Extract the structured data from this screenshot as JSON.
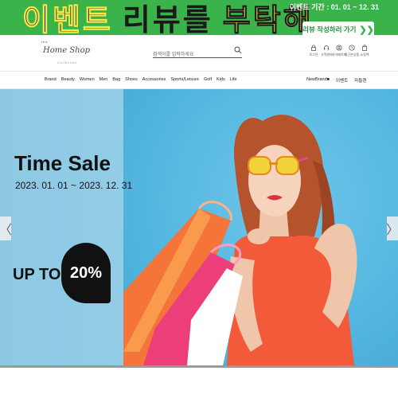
{
  "event_banner": {
    "slogan_part1": "이벤트",
    "slogan_part2": "리뷰를",
    "slogan_part3": "부탁해",
    "period": "이벤트 기간 : 01. 01 ~ 12. 31",
    "cta_label": "리뷰 작성하러 가기",
    "cta_arrows": "❯❯",
    "color_bg": "#39b34a"
  },
  "header": {
    "logo": {
      "the": "the",
      "name": "Home Shop",
      "sub": "Collection"
    },
    "search": {
      "placeholder": "검색어를 입력하세요"
    },
    "utility": [
      {
        "label": "로그인",
        "icon": "lock-icon"
      },
      {
        "label": "고객센터",
        "icon": "headset-icon"
      },
      {
        "label": "마이페이지",
        "icon": "user-icon"
      },
      {
        "label": "최근본상품",
        "icon": "clock-icon"
      },
      {
        "label": "쇼핑백",
        "icon": "shopping-bag-icon"
      }
    ]
  },
  "nav": {
    "categories": [
      "Brand",
      "Beauty",
      "Women",
      "Men",
      "Bag",
      "Shoes",
      "Accessories",
      "Sports/Leisure",
      "Golf",
      "Kids",
      "Life"
    ],
    "right": [
      "NewBrand■",
      "이벤트",
      "마들렌"
    ]
  },
  "hero": {
    "title": "Time Sale",
    "dates": "2023. 01. 01 ~ 2023. 12. 31",
    "up_to": "UP TO",
    "discount": "20%",
    "prev_arrow": "〈",
    "next_arrow": "〉",
    "progress": 1.0
  }
}
